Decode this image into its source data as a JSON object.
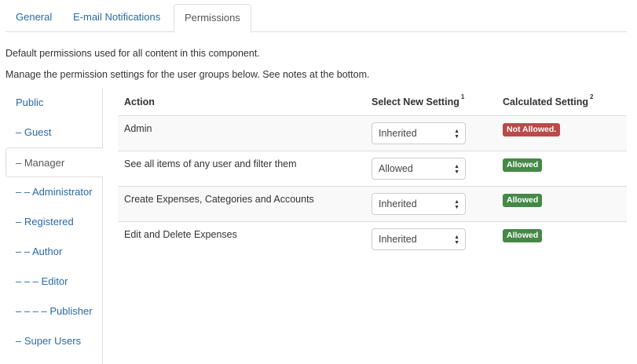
{
  "tabs": [
    {
      "label": "General"
    },
    {
      "label": "E-mail Notifications"
    },
    {
      "label": "Permissions"
    }
  ],
  "intro": {
    "line1": "Default permissions used for all content in this component.",
    "line2": "Manage the permission settings for the user groups below. See notes at the bottom."
  },
  "sidebar": {
    "items": [
      {
        "label": "Public"
      },
      {
        "label": "– Guest"
      },
      {
        "label": "– Manager"
      },
      {
        "label": "– – Administrator"
      },
      {
        "label": "– Registered"
      },
      {
        "label": "– – Author"
      },
      {
        "label": "– – – Editor"
      },
      {
        "label": "– – – – Publisher"
      },
      {
        "label": "– Super Users"
      }
    ],
    "active_index": 2
  },
  "table": {
    "headers": {
      "action": "Action",
      "select_new": "Select New Setting",
      "select_new_note": "1",
      "calculated": "Calculated Setting",
      "calculated_note": "2"
    },
    "rows": [
      {
        "action": "Admin",
        "setting": "Inherited",
        "calculated": "Not Allowed.",
        "status": "denied"
      },
      {
        "action": "See all items of any user and filter them",
        "setting": "Allowed",
        "calculated": "Allowed",
        "status": "allowed"
      },
      {
        "action": "Create Expenses, Categories and Accounts",
        "setting": "Inherited",
        "calculated": "Allowed",
        "status": "allowed"
      },
      {
        "action": "Edit and Delete Expenses",
        "setting": "Inherited",
        "calculated": "Allowed",
        "status": "allowed"
      }
    ]
  },
  "colors": {
    "link": "#2a6aa4",
    "allowed_badge": "#468847",
    "denied_badge": "#b94a48",
    "border": "#dddddd"
  }
}
